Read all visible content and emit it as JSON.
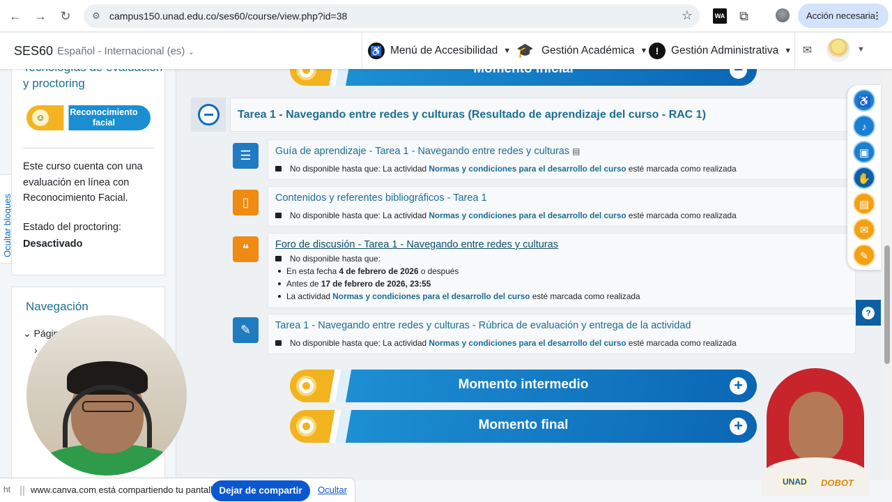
{
  "browser": {
    "url": "campus150.unad.edu.co/ses60/course/view.php?id=38",
    "action_pill": "Acción necesaria",
    "ext_wa": "WA"
  },
  "header": {
    "site_name": "SES60",
    "language": "Español - Internacional (es)",
    "menu_accessibility": "Menú de Accesibilidad",
    "menu_academic": "Gestión Académica",
    "menu_admin": "Gestión Administrativa"
  },
  "drawer": {
    "toggle_label": "Ocultar bloques",
    "proctoring_block": {
      "title": "Tecnologías de evaluación y proctoring",
      "badge": "Reconocimiento facial",
      "description": "Este curso cuenta con una evaluación en línea con Reconocimiento Facial.",
      "state_label": "Estado del proctoring:",
      "state_value": "Desactivado"
    },
    "nav_block": {
      "title": "Navegación",
      "item1": "Págin"
    }
  },
  "course": {
    "moment_initial": "Momento inicial",
    "section_title": "Tarea 1 - Navegando entre redes y culturas (Resultado de aprendizaje del curso - RAC 1)",
    "restriction_prefix": "No disponible hasta que: La actividad",
    "restriction_link": "Normas y condiciones para el desarrollo del curso",
    "restriction_suffix": "esté marcada como realizada",
    "activities": [
      {
        "title": "Guía de aprendizaje - Tarea 1 - Navegando entre redes y culturas",
        "color": "#1f7cc1",
        "icon": "guide-icon"
      },
      {
        "title": "Contenidos y referentes bibliográficos - Tarea 1",
        "color": "#ef8a12",
        "icon": "book-icon"
      },
      {
        "title": "Foro de discusión - Tarea 1 - Navegando entre redes y culturas",
        "color": "#ef8a12",
        "icon": "forum-icon",
        "restriction_head": "No disponible hasta que:",
        "date_from_prefix": "En esta fecha",
        "date_from": "4 de febrero de 2026",
        "date_from_suffix": "o después",
        "date_to_prefix": "Antes de",
        "date_to": "17 de febrero de 2026, 23:55",
        "activity_prefix": "La actividad"
      },
      {
        "title": "Tarea 1 - Navegando entre redes y culturas - Rúbrica de evaluación y entrega de la actividad",
        "color": "#1f7cc1",
        "icon": "assignment-icon"
      }
    ],
    "moment_intermediate": "Momento intermedio",
    "moment_final": "Momento final"
  },
  "bot": {
    "logo_unad": "UNAD",
    "logo_dobot": "DOBOT"
  },
  "share_bar": {
    "snippet": "ht",
    "message": "www.canva.com está compartiendo tu pantalla.",
    "stop_button": "Dejar de compartir",
    "hide_link": "Ocultar"
  }
}
